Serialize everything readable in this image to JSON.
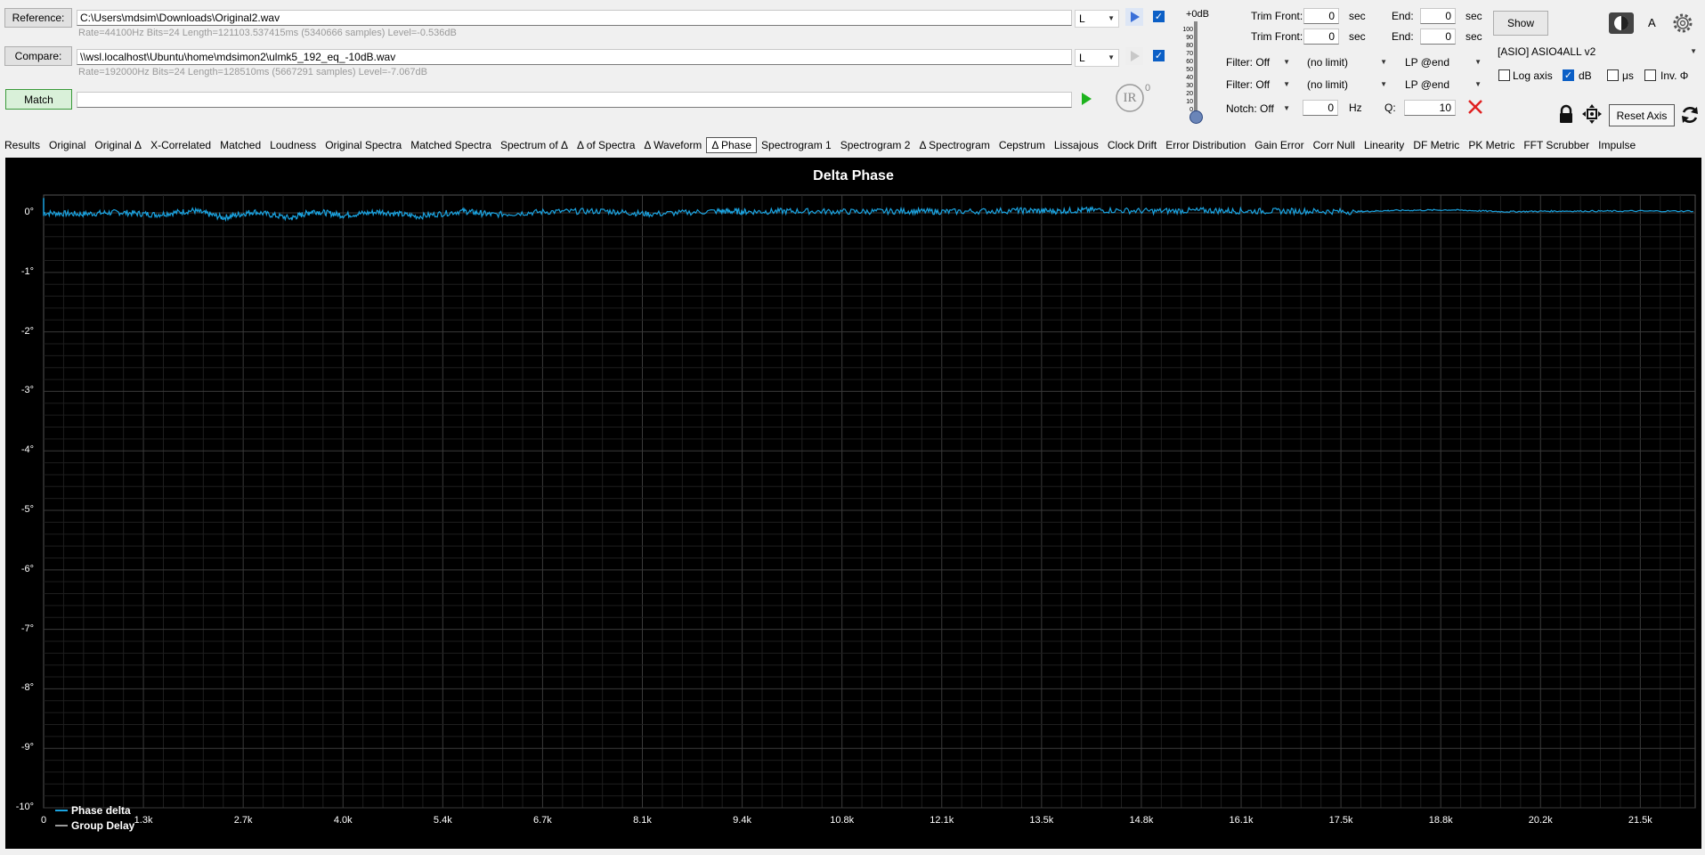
{
  "reference": {
    "button_label": "Reference:",
    "path": "C:\\Users\\mdsim\\Downloads\\Original2.wav",
    "info": "Rate=44100Hz Bits=24 Length=121103.537415ms (5340666 samples) Level=-0.536dB",
    "channel": "L"
  },
  "compare": {
    "button_label": "Compare:",
    "path": "\\\\wsl.localhost\\Ubuntu\\home\\mdsimon2\\ulmk5_192_eq_-10dB.wav",
    "info": "Rate=192000Hz Bits=24 Length=128510ms (5667291 samples) Level=-7.067dB",
    "channel": "L"
  },
  "match": {
    "button_label": "Match",
    "field": ""
  },
  "ir_label": "IR",
  "ir_count": "0",
  "volume": {
    "label": "+0dB",
    "scale": [
      "100",
      "90",
      "80",
      "70",
      "60",
      "50",
      "40",
      "30",
      "20",
      "10",
      "0"
    ],
    "level_percent": 0
  },
  "trim": {
    "rows": [
      {
        "front_label": "Trim Front:",
        "front": "0",
        "unit": "sec",
        "end_label": "End:",
        "end": "0",
        "end_unit": "sec"
      },
      {
        "front_label": "Trim Front:",
        "front": "0",
        "unit": "sec",
        "end_label": "End:",
        "end": "0",
        "end_unit": "sec"
      }
    ]
  },
  "filters": {
    "rows": [
      {
        "filter": "Filter: Off",
        "limit": "(no limit)",
        "lp": "LP @end"
      },
      {
        "filter": "Filter: Off",
        "limit": "(no limit)",
        "lp": "LP @end"
      }
    ],
    "notch": "Notch: Off",
    "notch_hz": "0",
    "hz_unit": "Hz",
    "q_label": "Q:",
    "q_value": "10"
  },
  "right": {
    "show_label": "Show",
    "a_label": "A",
    "device": "[ASIO] ASIO4ALL v2",
    "log_axis": "Log axis",
    "db": "dB",
    "us": "μs",
    "inv": "Inv. Φ",
    "log_axis_checked": false,
    "db_checked": true,
    "us_checked": false,
    "inv_checked": false,
    "reset_axis": "Reset Axis"
  },
  "tabs": [
    "Results",
    "Original",
    "Original Δ",
    "X-Correlated",
    "Matched",
    "Loudness",
    "Original Spectra",
    "Matched Spectra",
    "Spectrum of Δ",
    "Δ of Spectra",
    "Δ Waveform",
    "Δ Phase",
    "Spectrogram 1",
    "Spectrogram 2",
    "Δ Spectrogram",
    "Cepstrum",
    "Lissajous",
    "Clock Drift",
    "Error Distribution",
    "Gain Error",
    "Corr Null",
    "Linearity",
    "DF Metric",
    "PK Metric",
    "FFT Scrubber",
    "Impulse"
  ],
  "active_tab": "Δ Phase",
  "colors": {
    "phase": "#1aa3e0",
    "group_delay": "#9a9a9a",
    "grid": "#3a3a3a"
  },
  "chart_data": {
    "type": "line",
    "title": "Delta Phase",
    "xlabel": "",
    "ylabel": "",
    "xlim": [
      0,
      22050
    ],
    "ylim": [
      -10,
      0.3
    ],
    "x_ticks": [
      "0",
      "1.3k",
      "2.7k",
      "4.0k",
      "5.4k",
      "6.7k",
      "8.1k",
      "9.4k",
      "10.8k",
      "12.1k",
      "13.5k",
      "14.8k",
      "16.1k",
      "17.5k",
      "18.8k",
      "20.2k",
      "21.5k"
    ],
    "y_ticks": [
      "0°",
      "-1°",
      "-2°",
      "-3°",
      "-4°",
      "-5°",
      "-6°",
      "-7°",
      "-8°",
      "-9°",
      "-10°"
    ],
    "grid": true,
    "legend_position": "bottom-left",
    "series": [
      {
        "name": "Phase delta",
        "x": [
          0,
          500,
          1000,
          1500,
          2000,
          2400,
          2800,
          3300,
          3600,
          4000,
          4500,
          5000,
          5600,
          6000,
          6700,
          7500,
          8100,
          9000,
          9400,
          10000,
          10800,
          11500,
          12100,
          13000,
          13500,
          14000,
          14800,
          15500,
          16100,
          16800,
          17500,
          18000,
          18800,
          19500,
          20200,
          21000,
          22050
        ],
        "y": [
          0,
          -0.02,
          0.01,
          -0.03,
          0.04,
          -0.08,
          0.02,
          -0.09,
          0.03,
          -0.04,
          0.02,
          -0.06,
          0.03,
          -0.03,
          0.02,
          0.03,
          -0.02,
          0.03,
          0.02,
          0.03,
          0.02,
          0.03,
          0.02,
          0.04,
          0.03,
          0.05,
          0.03,
          0.04,
          0.03,
          0.03,
          0.02,
          0.04,
          0.05,
          0.02,
          0.03,
          0.03,
          0.03
        ]
      },
      {
        "name": "Group Delay",
        "x": [],
        "y": []
      }
    ]
  }
}
